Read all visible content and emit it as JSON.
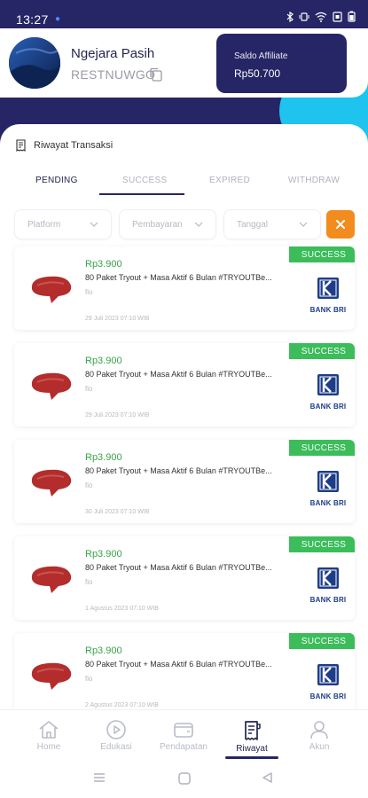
{
  "status_bar": {
    "time": "13:27",
    "accent_dot": "●"
  },
  "profile": {
    "name": "Ngejara Pasih",
    "code": "RESTNUWGO",
    "saldo_label": "Saldo Affiliate",
    "saldo_value": "Rp50.700"
  },
  "section_title": "Riwayat Transaksi",
  "tabs": [
    {
      "label": "PENDING"
    },
    {
      "label": "SUCCESS"
    },
    {
      "label": "EXPIRED"
    },
    {
      "label": "WITHDRAW"
    }
  ],
  "filters": {
    "platform": "Platform",
    "pembayaran": "Pembayaran",
    "tanggal": "Tanggal"
  },
  "transactions": [
    {
      "status": "SUCCESS",
      "amount": "Rp3.900",
      "title": "80 Paket Tryout + Masa Aktif 6 Bulan #TRYOUTBe...",
      "sub": "fio",
      "date": "29 Juli 2023 07:10 WIB",
      "bank": "BANK BRI"
    },
    {
      "status": "SUCCESS",
      "amount": "Rp3.900",
      "title": "80 Paket Tryout + Masa Aktif 6 Bulan #TRYOUTBe...",
      "sub": "fio",
      "date": "29 Juli 2023 07:10 WIB",
      "bank": "BANK BRI"
    },
    {
      "status": "SUCCESS",
      "amount": "Rp3.900",
      "title": "80 Paket Tryout + Masa Aktif 6 Bulan #TRYOUTBe...",
      "sub": "fio",
      "date": "30 Juli 2023 07:10 WIB",
      "bank": "BANK BRI"
    },
    {
      "status": "SUCCESS",
      "amount": "Rp3.900",
      "title": "80 Paket Tryout + Masa Aktif 6 Bulan #TRYOUTBe...",
      "sub": "fio",
      "date": "1 Agustus 2023 07:10 WIB",
      "bank": "BANK BRI"
    },
    {
      "status": "SUCCESS",
      "amount": "Rp3.900",
      "title": "80 Paket Tryout + Masa Aktif 6 Bulan #TRYOUTBe...",
      "sub": "fio",
      "date": "2 Agustus 2023 07:10 WIB",
      "bank": "BANK BRI"
    }
  ],
  "bottom_nav": [
    {
      "label": "Home",
      "icon": "home-icon"
    },
    {
      "label": "Edukasi",
      "icon": "play-icon"
    },
    {
      "label": "Pendapatan",
      "icon": "wallet-icon"
    },
    {
      "label": "Riwayat",
      "icon": "receipt-icon"
    },
    {
      "label": "Akun",
      "icon": "user-icon"
    }
  ],
  "colors": {
    "primary": "#262566",
    "accent": "#1ec3ee",
    "success": "#3bbd5a",
    "amount": "#3aa34a",
    "clear_button": "#f28c1e"
  }
}
